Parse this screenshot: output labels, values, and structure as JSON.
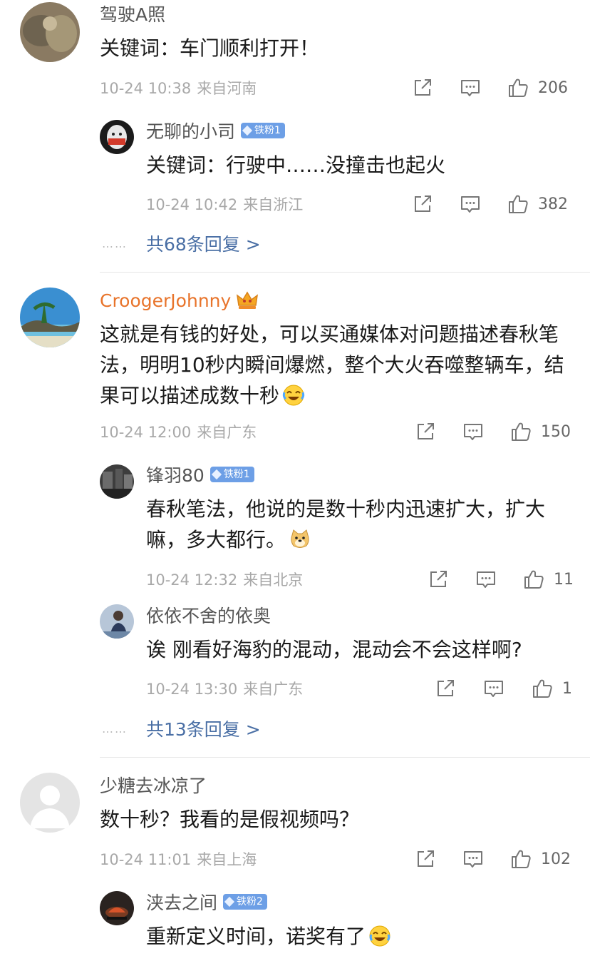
{
  "comments": [
    {
      "user": "驾驶A照",
      "text": "关键词：车门顺利打开！",
      "time": "10-24 10:38",
      "location": "来自河南",
      "likes": "206",
      "replies": [
        {
          "user": "无聊的小司",
          "badge": "铁粉1",
          "text": "关键词：行驶中……没撞击也起火",
          "time": "10-24 10:42",
          "location": "来自浙江",
          "likes": "382"
        }
      ],
      "more_replies": "共68条回复 >"
    },
    {
      "user": "CroogerJohnny",
      "text": "这就是有钱的好处，可以买通媒体对问题描述春秋笔法，明明10秒内瞬间爆燃，整个大火吞噬整辆车，结果可以描述成数十秒",
      "emoji": "laugh-cry-emoji",
      "time": "10-24 12:00",
      "location": "来自广东",
      "likes": "150",
      "replies": [
        {
          "user": "锋羽80",
          "badge": "铁粉1",
          "text": "春秋笔法，他说的是数十秒内迅速扩大，扩大嘛，多大都行。",
          "emoji": "doge-emoji",
          "time": "10-24 12:32",
          "location": "来自北京",
          "likes": "11"
        },
        {
          "user": "依依不舍的依奥",
          "text": "诶 刚看好海豹的混动，混动会不会这样啊?",
          "time": "10-24 13:30",
          "location": "来自广东",
          "likes": "1"
        }
      ],
      "more_replies": "共13条回复 >"
    },
    {
      "user": "少糖去冰凉了",
      "text": "数十秒？我看的是假视频吗？",
      "time": "10-24 11:01",
      "location": "来自上海",
      "likes": "102",
      "replies": [
        {
          "user": "浃去之间",
          "badge": "铁粉2",
          "text": "重新定义时间，诺奖有了",
          "emoji": "laugh-emoji"
        }
      ]
    }
  ],
  "dots": "……",
  "colors": {
    "name": "#555555",
    "vip_name": "#e8742b",
    "link": "#4a6fa5",
    "badge": "#6d9fe6",
    "meta": "#a8a8a8"
  }
}
